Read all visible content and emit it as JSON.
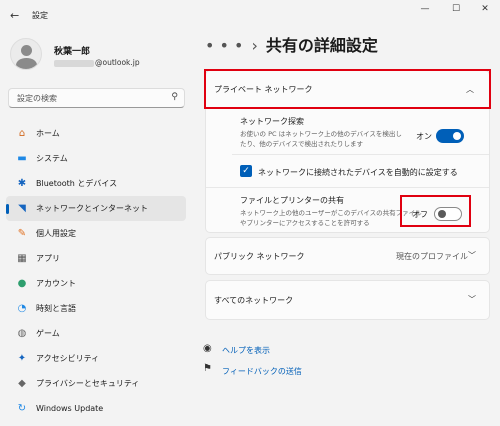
{
  "app": {
    "title": "設定"
  },
  "window": {
    "minimize": "—",
    "maximize": "☐",
    "close": "✕"
  },
  "profile": {
    "name": "秋葉一郎",
    "email_suffix": "@outlook.jp"
  },
  "search": {
    "placeholder": "設定の検索"
  },
  "sidebar": {
    "items": [
      {
        "label": "ホーム",
        "icon": "home-icon",
        "glyph": "⌂",
        "color": "#d2691e"
      },
      {
        "label": "システム",
        "icon": "system-icon",
        "glyph": "▬",
        "color": "#1e88e5"
      },
      {
        "label": "Bluetooth とデバイス",
        "icon": "bluetooth-icon",
        "glyph": "✱",
        "color": "#1565c0"
      },
      {
        "label": "ネットワークとインターネット",
        "icon": "wifi-icon",
        "glyph": "◥",
        "color": "#1565c0",
        "active": true
      },
      {
        "label": "個人用設定",
        "icon": "brush-icon",
        "glyph": "✎",
        "color": "#e07020"
      },
      {
        "label": "アプリ",
        "icon": "apps-icon",
        "glyph": "▦",
        "color": "#555"
      },
      {
        "label": "アカウント",
        "icon": "account-icon",
        "glyph": "●",
        "color": "#2e9e6e"
      },
      {
        "label": "時刻と言語",
        "icon": "clock-language-icon",
        "glyph": "◔",
        "color": "#1e88e5"
      },
      {
        "label": "ゲーム",
        "icon": "game-icon",
        "glyph": "◍",
        "color": "#666"
      },
      {
        "label": "アクセシビリティ",
        "icon": "accessibility-icon",
        "glyph": "✦",
        "color": "#1565c0"
      },
      {
        "label": "プライバシーとセキュリティ",
        "icon": "shield-icon",
        "glyph": "◆",
        "color": "#666"
      },
      {
        "label": "Windows Update",
        "icon": "update-icon",
        "glyph": "↻",
        "color": "#1e88e5"
      }
    ]
  },
  "breadcrumb": {
    "dots": "• • •",
    "sep": "›",
    "title": "共有の詳細設定"
  },
  "private_section": {
    "title": "プライベート ネットワーク",
    "discovery": {
      "title": "ネットワーク探索",
      "desc_line1": "お使いの PC はネットワーク上の他のデバイスを検出し",
      "desc_line2": "たり、他のデバイスで検出されたりします",
      "state": "オン",
      "on": true
    },
    "auto_setup": {
      "label": "ネットワークに接続されたデバイスを自動的に設定する",
      "checked": true
    },
    "sharing": {
      "title": "ファイルとプリンターの共有",
      "desc_line1": "ネットワーク上の他のユーザーがこのデバイスの共有ファイル",
      "desc_line2": "やプリンターにアクセスすることを許可する",
      "state": "オフ",
      "on": false
    }
  },
  "public_section": {
    "title": "パブリック ネットワーク",
    "value": "現在のプロファイル"
  },
  "all_section": {
    "title": "すべてのネットワーク"
  },
  "help": {
    "get_help": "ヘルプを表示",
    "feedback": "フィードバックの送信"
  },
  "colors": {
    "accent": "#005fb8",
    "highlight": "#e00010"
  }
}
